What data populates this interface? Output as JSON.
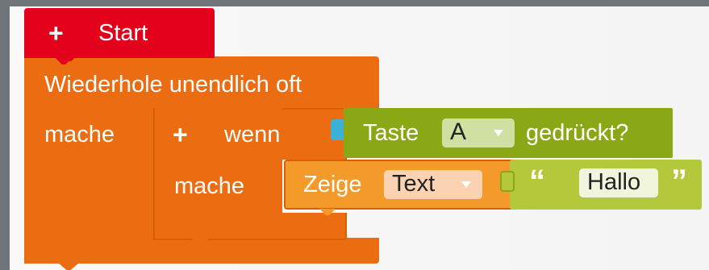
{
  "colors": {
    "start": "#e2001a",
    "control": "#ec6c12",
    "control_border": "#d05800",
    "sensor": "#8aa815",
    "text_lit": "#b3c83a",
    "dropdown_green": "#cfe0a2",
    "dropdown_orange": "#fbd3b3",
    "text_field": "#f0f5dc"
  },
  "start_block": {
    "icon": "plus-icon",
    "label": "Start"
  },
  "repeat_block": {
    "label": "Wiederhole unendlich oft",
    "do_label": "mache"
  },
  "if_block": {
    "icon": "plus-icon",
    "label": "wenn",
    "do_label": "mache"
  },
  "condition_block": {
    "prefix": "Taste",
    "key_value": "A",
    "suffix": "gedrückt?"
  },
  "show_block": {
    "label": "Zeige",
    "type_value": "Text"
  },
  "text_block": {
    "open_quote": "“",
    "value": "Hallo",
    "close_quote": "”"
  }
}
